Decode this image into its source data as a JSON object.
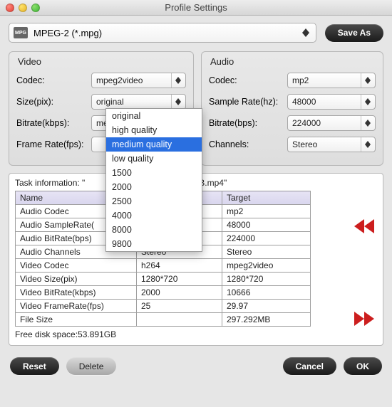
{
  "window": {
    "title": "Profile Settings"
  },
  "profile": {
    "format_label": "MPEG-2 (*.mpg)",
    "icon_text": "MPG",
    "save_as": "Save As"
  },
  "video_group": {
    "title": "Video",
    "codec_label": "Codec:",
    "codec_value": "mpeg2video",
    "size_label": "Size(pix):",
    "size_value": "original",
    "bitrate_label": "Bitrate(kbps):",
    "bitrate_value": "medium quality",
    "framerate_label": "Frame Rate(fps):",
    "framerate_value": ""
  },
  "audio_group": {
    "title": "Audio",
    "codec_label": "Codec:",
    "codec_value": "mp2",
    "samplerate_label": "Sample Rate(hz):",
    "samplerate_value": "48000",
    "bitrate_label": "Bitrate(bps):",
    "bitrate_value": "224000",
    "channels_label": "Channels:",
    "channels_value": "Stereo"
  },
  "bitrate_dropdown": {
    "options": [
      "original",
      "high quality",
      "medium quality",
      "low quality",
      "1500",
      "2000",
      "2500",
      "4000",
      "8000",
      "9800"
    ],
    "selected_index": 2
  },
  "task": {
    "title_prefix": "Task information: \"",
    "title_mid": "MB.mp4\"",
    "col_name": "Name",
    "col_target": "Target",
    "rows": [
      {
        "name": "Audio Codec",
        "src": "",
        "tgt": "mp2"
      },
      {
        "name": "Audio SampleRate(",
        "src": "",
        "tgt": "48000"
      },
      {
        "name": "Audio BitRate(bps)",
        "src": "",
        "tgt": "224000"
      },
      {
        "name": "Audio Channels",
        "src": "Stereo",
        "tgt": "Stereo"
      },
      {
        "name": "Video Codec",
        "src": "h264",
        "tgt": "mpeg2video"
      },
      {
        "name": "Video Size(pix)",
        "src": "1280*720",
        "tgt": "1280*720"
      },
      {
        "name": "Video BitRate(kbps)",
        "src": "2000",
        "tgt": "10666"
      },
      {
        "name": "Video FrameRate(fps)",
        "src": "25",
        "tgt": "29.97"
      },
      {
        "name": "File Size",
        "src": "",
        "tgt": "297.292MB"
      }
    ],
    "free_disk_label": "Free disk space:",
    "free_disk_value": "53.891GB"
  },
  "footer": {
    "reset": "Reset",
    "delete": "Delete",
    "cancel": "Cancel",
    "ok": "OK"
  },
  "colors": {
    "accent": "#2a6fe0",
    "nav_arrow": "#cc1e1e"
  }
}
